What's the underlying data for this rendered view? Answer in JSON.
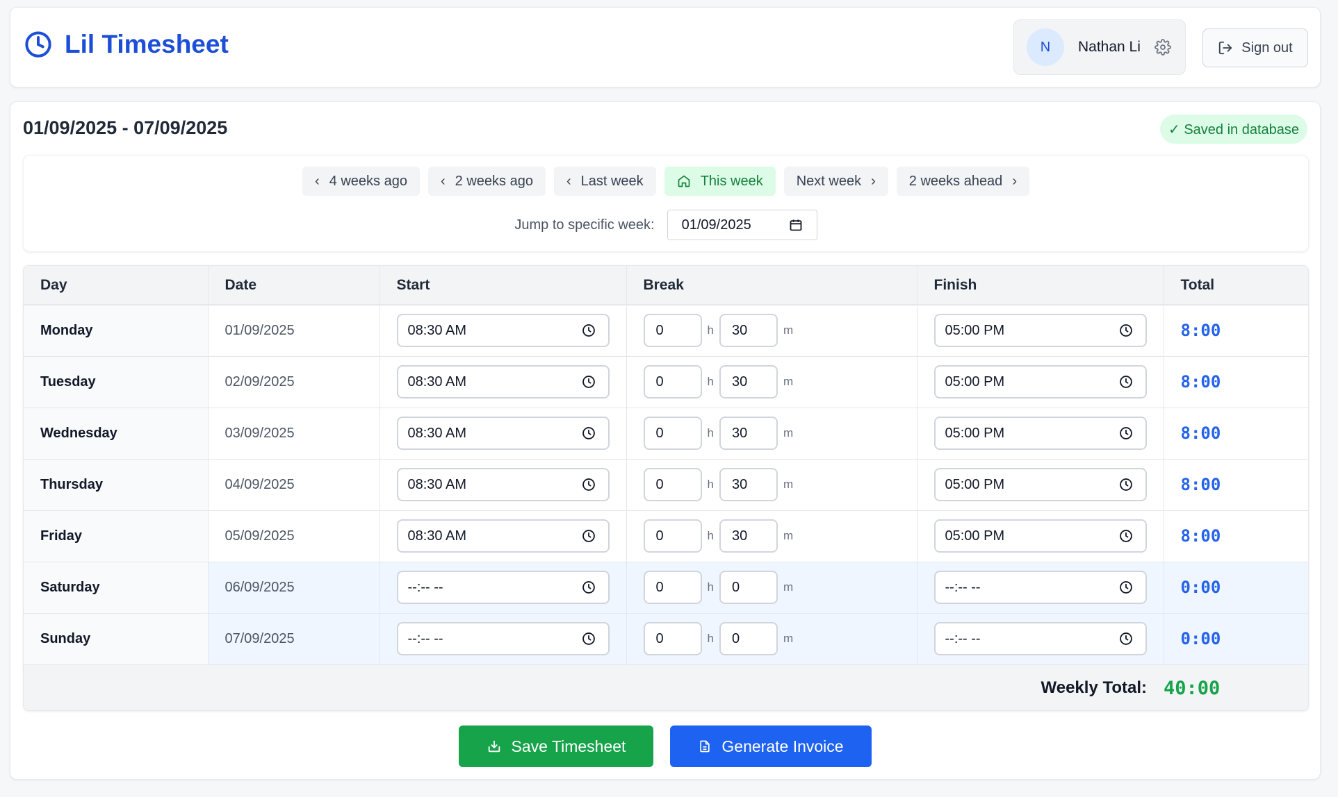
{
  "app": {
    "title": "Lil Timesheet"
  },
  "user": {
    "initial": "N",
    "name": "Nathan Li",
    "sign_out": "Sign out"
  },
  "range_title": "01/09/2025 - 07/09/2025",
  "status_badge": "✓ Saved in database",
  "week_nav": {
    "buttons": [
      {
        "label": "4 weeks ago"
      },
      {
        "label": "2 weeks ago"
      },
      {
        "label": "Last week"
      },
      {
        "label": "This week"
      },
      {
        "label": "Next week"
      },
      {
        "label": "2 weeks ahead"
      }
    ],
    "jump_label": "Jump to specific week:",
    "jump_value": "01/09/2025"
  },
  "table": {
    "headers": [
      "Day",
      "Date",
      "Start",
      "Break",
      "Finish",
      "Total"
    ],
    "break_units": {
      "hours": "h",
      "minutes": "m"
    },
    "rows": [
      {
        "day": "Monday",
        "date": "01/09/2025",
        "start": "08:30  AM",
        "break_h": "0",
        "break_m": "30",
        "finish": "05:00  PM",
        "total": "8:00"
      },
      {
        "day": "Tuesday",
        "date": "02/09/2025",
        "start": "08:30  AM",
        "break_h": "0",
        "break_m": "30",
        "finish": "05:00  PM",
        "total": "8:00"
      },
      {
        "day": "Wednesday",
        "date": "03/09/2025",
        "start": "08:30  AM",
        "break_h": "0",
        "break_m": "30",
        "finish": "05:00  PM",
        "total": "8:00"
      },
      {
        "day": "Thursday",
        "date": "04/09/2025",
        "start": "08:30  AM",
        "break_h": "0",
        "break_m": "30",
        "finish": "05:00  PM",
        "total": "8:00"
      },
      {
        "day": "Friday",
        "date": "05/09/2025",
        "start": "08:30  AM",
        "break_h": "0",
        "break_m": "30",
        "finish": "05:00  PM",
        "total": "8:00"
      },
      {
        "day": "Saturday",
        "date": "06/09/2025",
        "start": "--:-- --",
        "break_h": "0",
        "break_m": "0",
        "finish": "--:-- --",
        "total": "0:00"
      },
      {
        "day": "Sunday",
        "date": "07/09/2025",
        "start": "--:-- --",
        "break_h": "0",
        "break_m": "0",
        "finish": "--:-- --",
        "total": "0:00"
      }
    ],
    "weekly_label": "Weekly Total:",
    "weekly_total": "40:00"
  },
  "actions": {
    "save": "Save Timesheet",
    "invoice": "Generate Invoice"
  },
  "colors": {
    "primary": "#1d4ed8",
    "success": "#16a34a",
    "accent_blue": "#2563eb"
  }
}
